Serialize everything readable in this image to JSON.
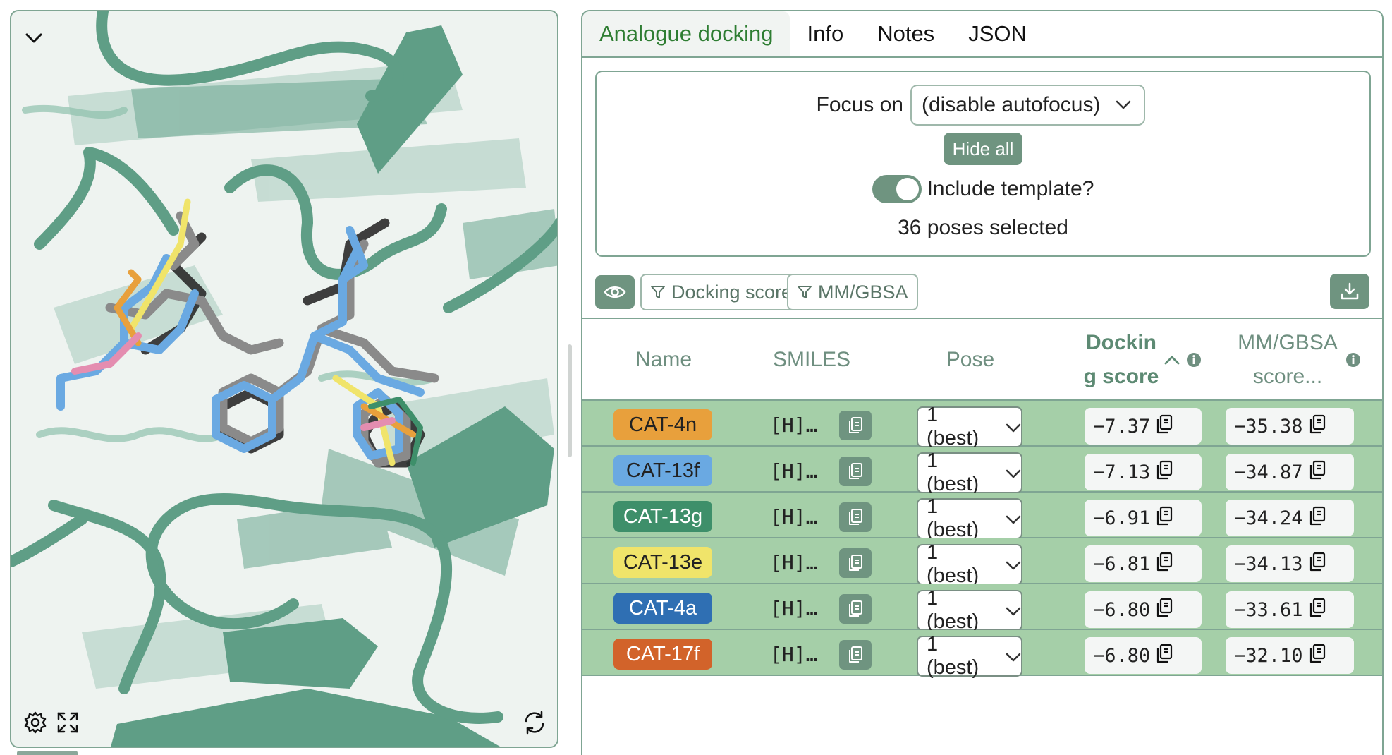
{
  "viewer": {
    "icons": {
      "collapse": "chevron-down-icon",
      "settings": "gear-icon",
      "fullscreen": "expand-icon",
      "reset": "rotate-icon"
    },
    "colors": {
      "protein": "#5f9e86",
      "background": "#eef3f0"
    }
  },
  "tabs": [
    {
      "label": "Analogue docking",
      "active": true
    },
    {
      "label": "Info",
      "active": false
    },
    {
      "label": "Notes",
      "active": false
    },
    {
      "label": "JSON",
      "active": false
    }
  ],
  "controls": {
    "focus_label": "Focus on",
    "focus_value": "(disable autofocus)",
    "hide_all_label": "Hide all",
    "include_template_label": "Include template?",
    "include_template_on": true,
    "poses_selected": "36 poses selected"
  },
  "filters": {
    "visibility_icon": "eye-icon",
    "docking_score_label": "Docking score",
    "mmgbsa_label": "MM/GBSA",
    "download_icon": "download-icon"
  },
  "table": {
    "headers": {
      "name": "Name",
      "smiles": "SMILES",
      "pose": "Pose",
      "docking_line1": "Dockin",
      "docking_line2": "g score",
      "mmgbsa_line1": "MM/GBSA",
      "mmgbsa_line2": "score..."
    },
    "rows": [
      {
        "name": "CAT-4n",
        "color": "#e8a03c",
        "smiles": "[H]…",
        "pose": "1 (best)",
        "docking": "−7.37",
        "mmgbsa": "−35.38"
      },
      {
        "name": "CAT-13f",
        "color": "#6aa9e2",
        "smiles": "[H]…",
        "pose": "1 (best)",
        "docking": "−7.13",
        "mmgbsa": "−34.87"
      },
      {
        "name": "CAT-13g",
        "color": "#3e8f6a",
        "smiles": "[H]…",
        "pose": "1 (best)",
        "docking": "−6.91",
        "mmgbsa": "−34.24"
      },
      {
        "name": "CAT-13e",
        "color": "#f0e46a",
        "smiles": "[H]…",
        "pose": "1 (best)",
        "docking": "−6.81",
        "mmgbsa": "−34.13"
      },
      {
        "name": "CAT-4a",
        "color": "#2f6fb3",
        "smiles": "[H]…",
        "pose": "1 (best)",
        "docking": "−6.80",
        "mmgbsa": "−33.61"
      },
      {
        "name": "CAT-17f",
        "color": "#d2632a",
        "smiles": "[H]…",
        "pose": "1 (best)",
        "docking": "−6.80",
        "mmgbsa": "−32.10"
      }
    ]
  }
}
